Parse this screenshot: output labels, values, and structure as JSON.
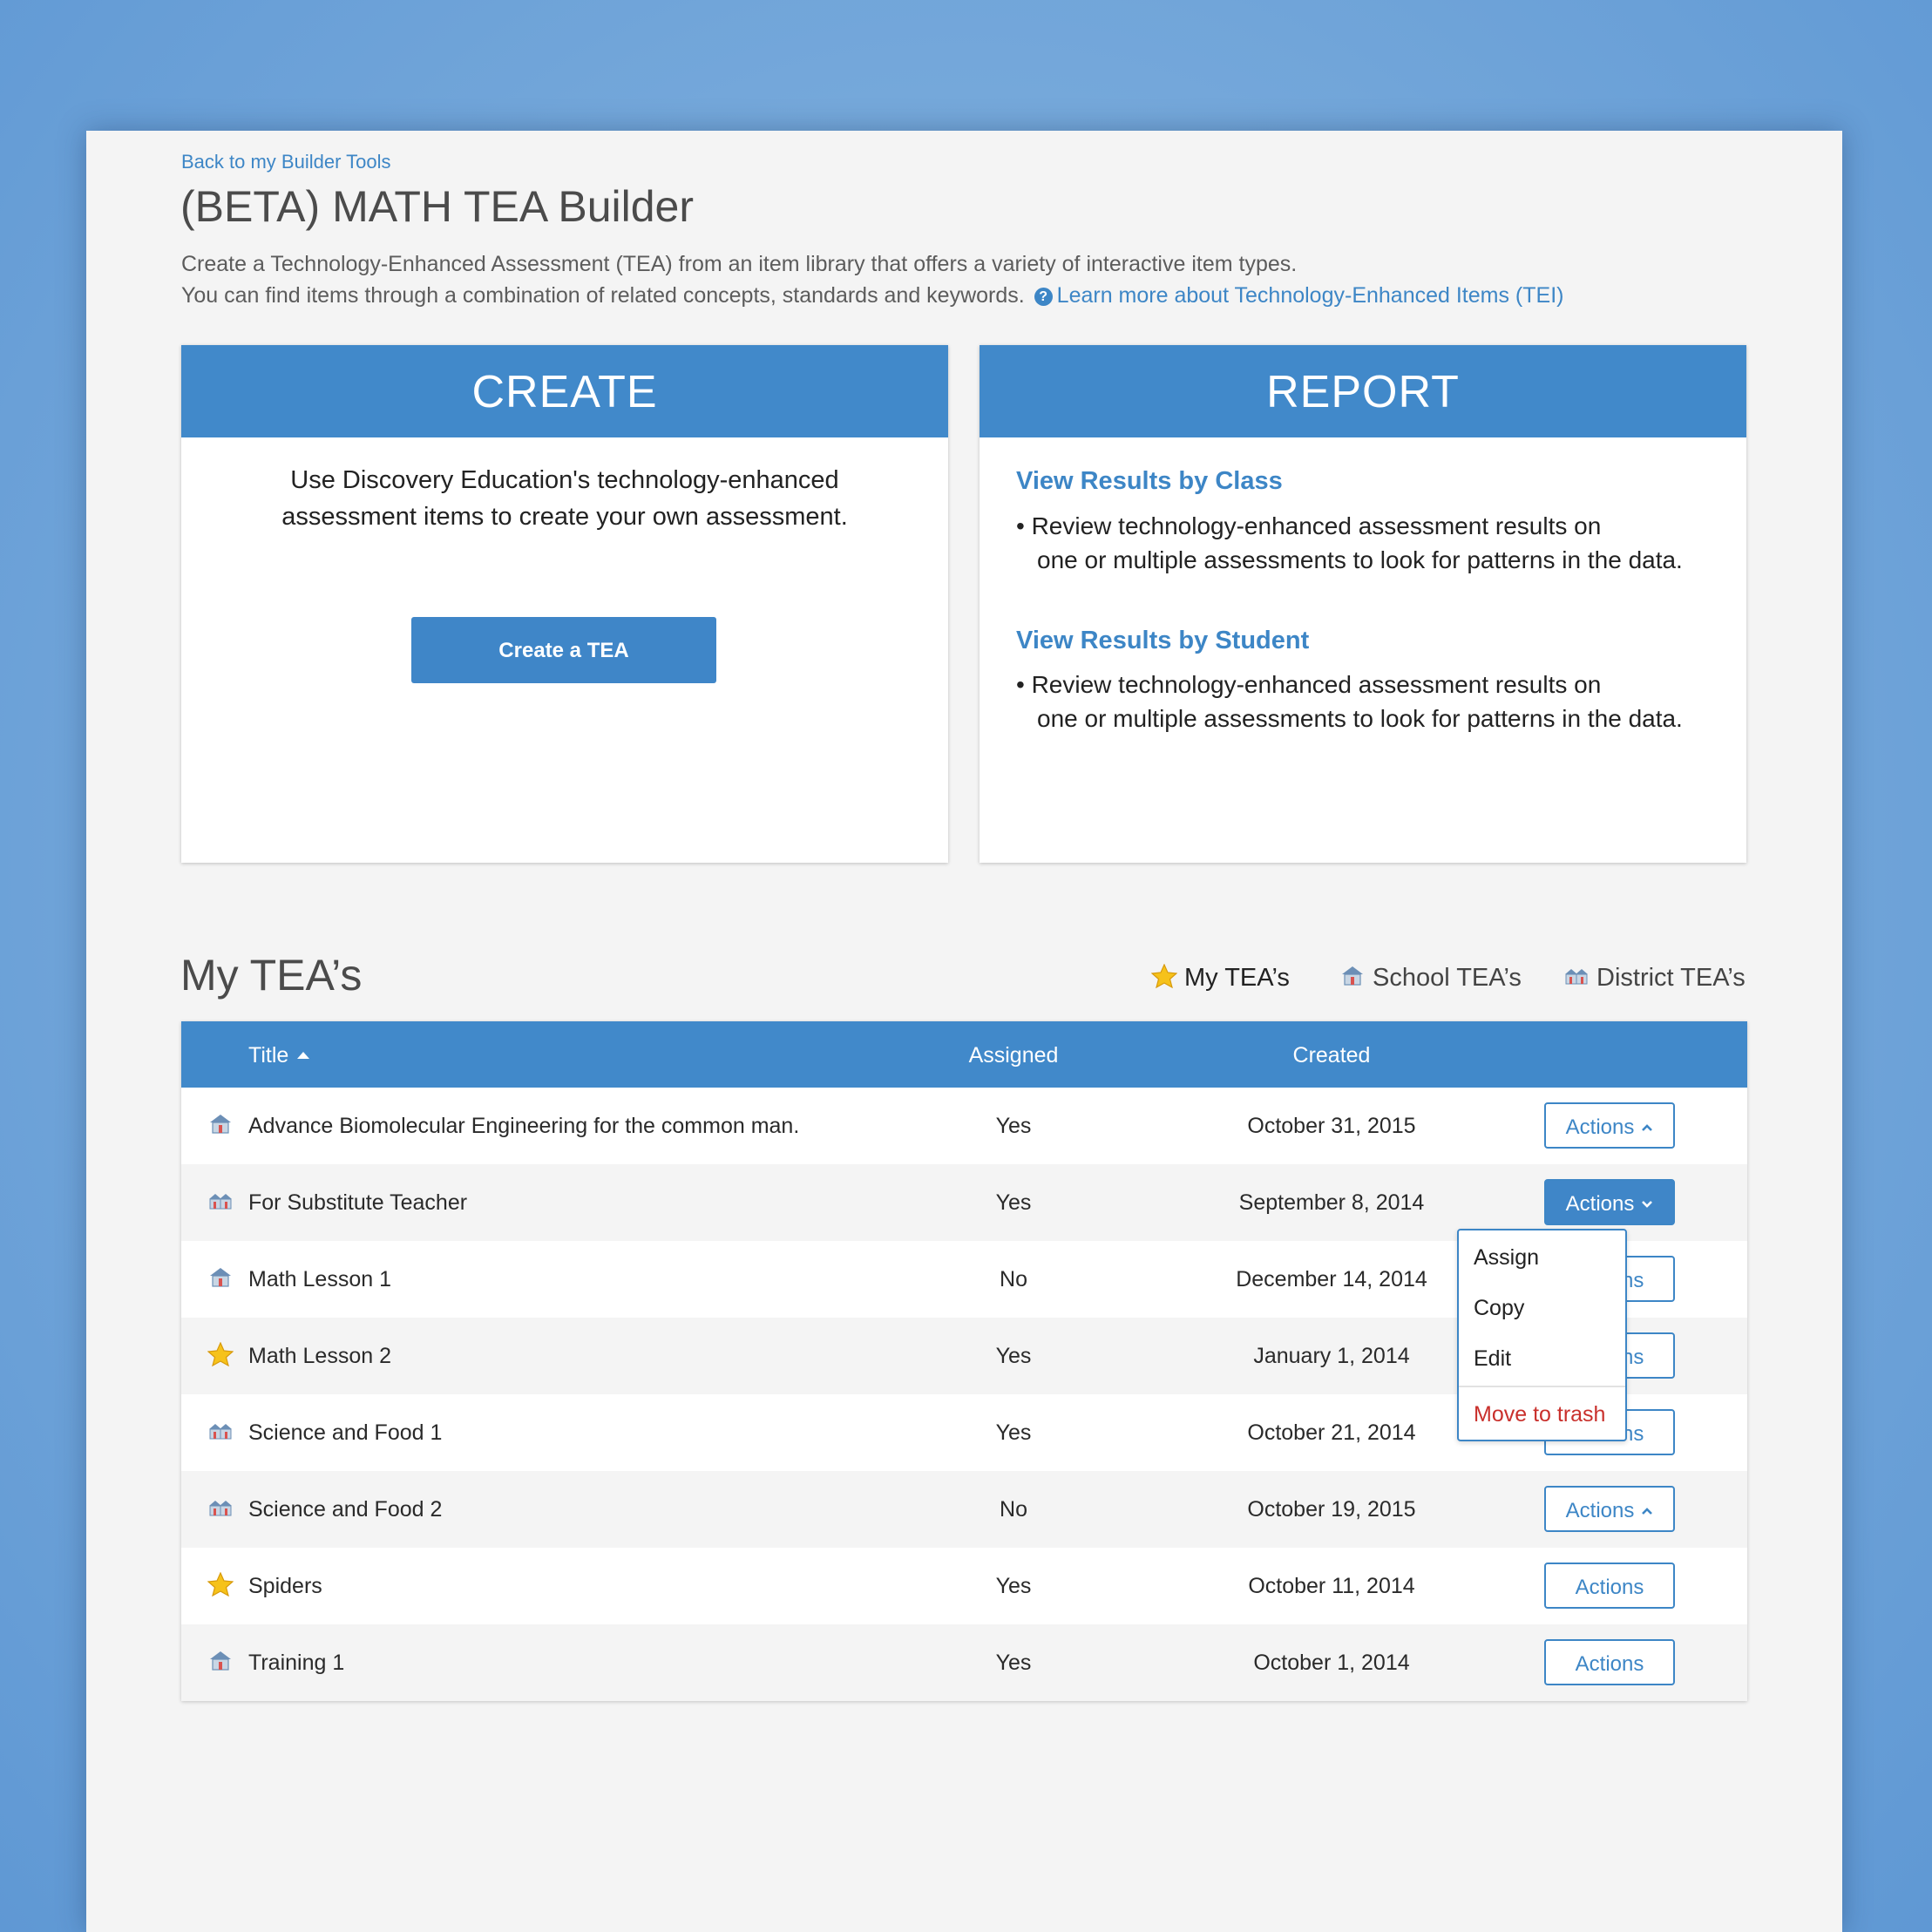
{
  "header": {
    "back_link": "Back to my Builder Tools",
    "title": "(BETA) MATH TEA Builder",
    "desc_line1": "Create a Technology-Enhanced Assessment (TEA) from an item library that offers a variety of interactive item types.",
    "desc_line2": "You can find items through a combination of related concepts, standards and keywords.",
    "learn_more": "Learn more about Technology-Enhanced Items (TEI)",
    "help_glyph": "?"
  },
  "create_panel": {
    "heading": "CREATE",
    "text_line1": "Use Discovery Education's technology-enhanced",
    "text_line2": "assessment items to create your own assessment.",
    "button": "Create a TEA"
  },
  "report_panel": {
    "heading": "REPORT",
    "by_class_link": "View Results by Class",
    "by_class_line1": "• Review technology-enhanced assessment results on",
    "by_class_line2": "one or multiple assessments to look for patterns in the data.",
    "by_student_link": "View Results by Student",
    "by_student_line1": "• Review technology-enhanced assessment results on",
    "by_student_line2": "one or multiple assessments to look for patterns in the data."
  },
  "list": {
    "title": "My TEA’s",
    "filters": [
      {
        "label": "My TEA’s",
        "icon": "star-icon"
      },
      {
        "label": "School TEA’s",
        "icon": "school-icon"
      },
      {
        "label": "District TEA’s",
        "icon": "district-icon"
      }
    ],
    "columns": {
      "title": "Title",
      "assigned": "Assigned",
      "created": "Created"
    },
    "rows": [
      {
        "icon": "school-icon",
        "title": "Advance Biomolecular Engineering for the common man.",
        "assigned": "Yes",
        "created": "October 31, 2015",
        "actions": "Actions",
        "chevron": "up"
      },
      {
        "icon": "district-icon",
        "title": "For Substitute Teacher",
        "assigned": "Yes",
        "created": "September 8, 2014",
        "actions": "Actions",
        "chevron": "down"
      },
      {
        "icon": "school-icon",
        "title": "Math Lesson 1",
        "assigned": "No",
        "created": "December 14, 2014",
        "actions": "Actions",
        "chevron": "none"
      },
      {
        "icon": "star-icon",
        "title": "Math Lesson 2",
        "assigned": "Yes",
        "created": "January 1, 2014",
        "actions": "Actions",
        "chevron": "none"
      },
      {
        "icon": "district-icon",
        "title": "Science and Food 1",
        "assigned": "Yes",
        "created": "October 21, 2014",
        "actions": "Actions",
        "chevron": "none"
      },
      {
        "icon": "district-icon",
        "title": "Science and Food 2",
        "assigned": "No",
        "created": "October 19, 2015",
        "actions": "Actions",
        "chevron": "up"
      },
      {
        "icon": "star-icon",
        "title": "Spiders",
        "assigned": "Yes",
        "created": "October 11, 2014",
        "actions": "Actions",
        "chevron": "none"
      },
      {
        "icon": "school-icon",
        "title": "Training 1",
        "assigned": "Yes",
        "created": "October 1, 2014",
        "actions": "Actions",
        "chevron": "none"
      }
    ],
    "dropdown": {
      "items": [
        "Assign",
        "Copy",
        "Edit"
      ],
      "danger_item": "Move to trash"
    }
  },
  "colors": {
    "accent": "#4189ca",
    "link": "#3d86c6",
    "danger": "#c9302c",
    "background": "#78aadb"
  }
}
